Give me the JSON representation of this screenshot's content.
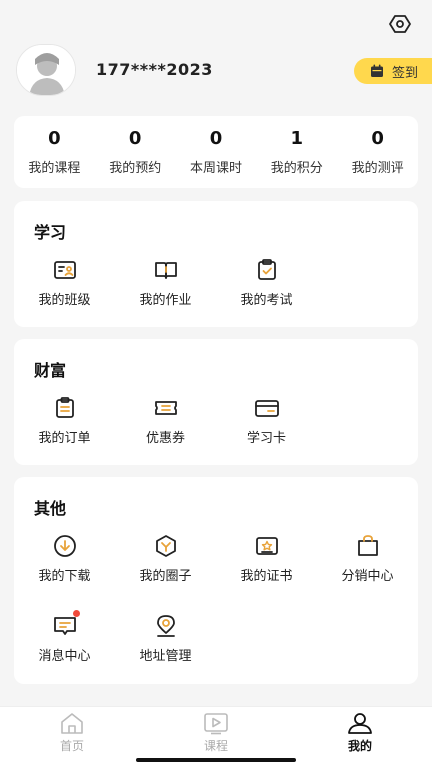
{
  "header": {
    "settings_icon": "settings-hexagon-icon"
  },
  "profile": {
    "phone": "177****2023",
    "signin_label": "签到",
    "signin_icon": "calendar-icon",
    "accent": "#ffd84d"
  },
  "stats": [
    {
      "value": "0",
      "label": "我的课程"
    },
    {
      "value": "0",
      "label": "我的预约"
    },
    {
      "value": "0",
      "label": "本周课时"
    },
    {
      "value": "1",
      "label": "我的积分"
    },
    {
      "value": "0",
      "label": "我的测评"
    }
  ],
  "learning": {
    "title": "学习",
    "items": [
      {
        "label": "我的班级",
        "icon": "class-card-icon"
      },
      {
        "label": "我的作业",
        "icon": "open-book-icon"
      },
      {
        "label": "我的考试",
        "icon": "exam-clipboard-icon"
      }
    ]
  },
  "wealth": {
    "title": "财富",
    "items": [
      {
        "label": "我的订单",
        "icon": "order-list-icon"
      },
      {
        "label": "优惠券",
        "icon": "coupon-icon"
      },
      {
        "label": "学习卡",
        "icon": "card-icon"
      }
    ]
  },
  "other": {
    "title": "其他",
    "items": [
      {
        "label": "我的下载",
        "icon": "download-icon"
      },
      {
        "label": "我的圈子",
        "icon": "circle-hexagon-icon"
      },
      {
        "label": "我的证书",
        "icon": "certificate-icon"
      },
      {
        "label": "分销中心",
        "icon": "shopping-bag-icon"
      },
      {
        "label": "消息中心",
        "icon": "message-icon",
        "badge": true
      },
      {
        "label": "地址管理",
        "icon": "location-pin-icon"
      }
    ]
  },
  "tabbar": [
    {
      "label": "首页",
      "icon": "home-icon",
      "active": false
    },
    {
      "label": "课程",
      "icon": "video-play-icon",
      "active": false
    },
    {
      "label": "我的",
      "icon": "user-icon",
      "active": true
    }
  ]
}
